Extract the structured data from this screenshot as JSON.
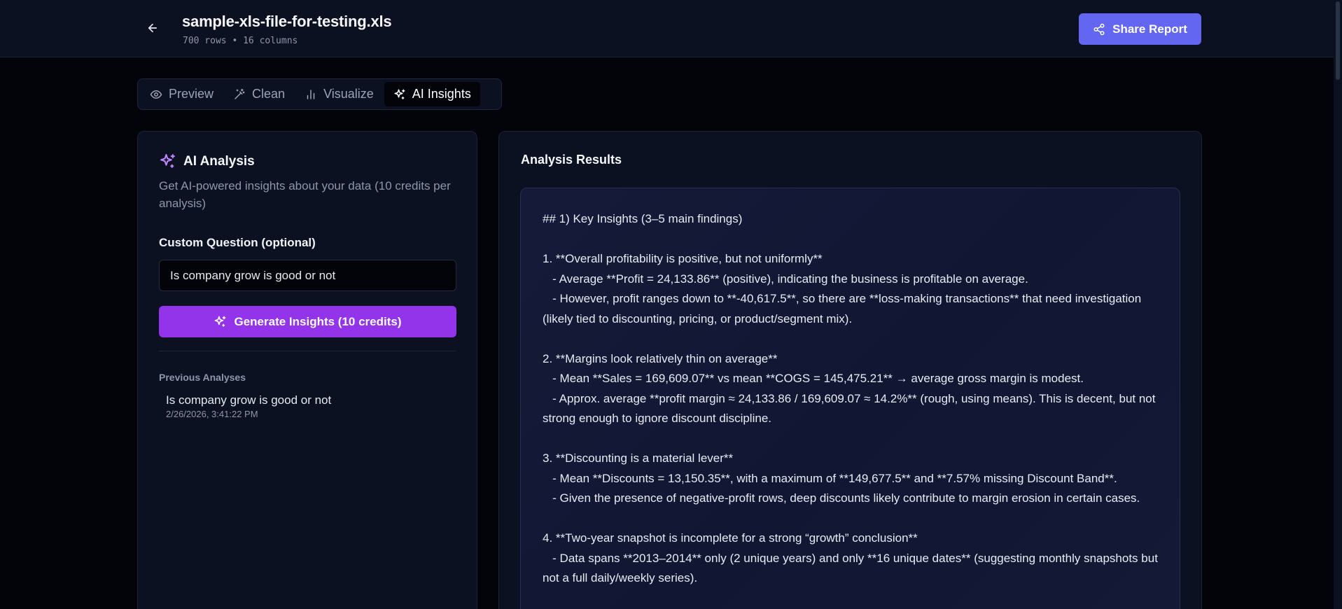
{
  "header": {
    "file_name": "sample-xls-file-for-testing.xls",
    "meta": "700 rows • 16 columns",
    "share_label": "Share Report"
  },
  "tabs": [
    {
      "label": "Preview",
      "icon": "eye-icon",
      "active": false
    },
    {
      "label": "Clean",
      "icon": "magic-wand-icon",
      "active": false
    },
    {
      "label": "Visualize",
      "icon": "bar-chart-icon",
      "active": false
    },
    {
      "label": "AI Insights",
      "icon": "sparkles-icon",
      "active": true
    }
  ],
  "ai_panel": {
    "title": "AI Analysis",
    "subtitle": "Get AI-powered insights about your data (10 credits per analysis)",
    "question_label": "Custom Question (optional)",
    "question_value": "Is company grow is good or not",
    "generate_label": "Generate Insights (10 credits)",
    "previous_label": "Previous Analyses",
    "previous": [
      {
        "question": "Is company grow is good or not",
        "date": "2/26/2026, 3:41:22 PM"
      }
    ]
  },
  "results": {
    "title": "Analysis Results",
    "body": "## 1) Key Insights (3–5 main findings)\n\n1. **Overall profitability is positive, but not uniformly**\n   - Average **Profit = 24,133.86** (positive), indicating the business is profitable on average.\n   - However, profit ranges down to **-40,617.5**, so there are **loss-making transactions** that need investigation (likely tied to discounting, pricing, or product/segment mix).\n\n2. **Margins look relatively thin on average**\n   - Mean **Sales = 169,609.07** vs mean **COGS = 145,475.21** → average gross margin is modest.\n   - Approx. average **profit margin ≈ 24,133.86 / 169,609.07 ≈ 14.2%** (rough, using means). This is decent, but not strong enough to ignore discount discipline.\n\n3. **Discounting is a material lever**\n   - Mean **Discounts = 13,150.35**, with a maximum of **149,677.5** and **7.57% missing Discount Band**.\n   - Given the presence of negative-profit rows, deep discounts likely contribute to margin erosion in certain cases.\n\n4. **Two-year snapshot is incomplete for a strong “growth” conclusion**\n   - Data spans **2013–2014** only (2 unique years) and only **16 unique dates** (suggesting monthly snapshots but not a full daily/weekly series)."
  },
  "colors": {
    "accent_indigo": "#6366f1",
    "accent_purple": "#9333ea",
    "background": "#020409",
    "panel": "#0b1120"
  }
}
